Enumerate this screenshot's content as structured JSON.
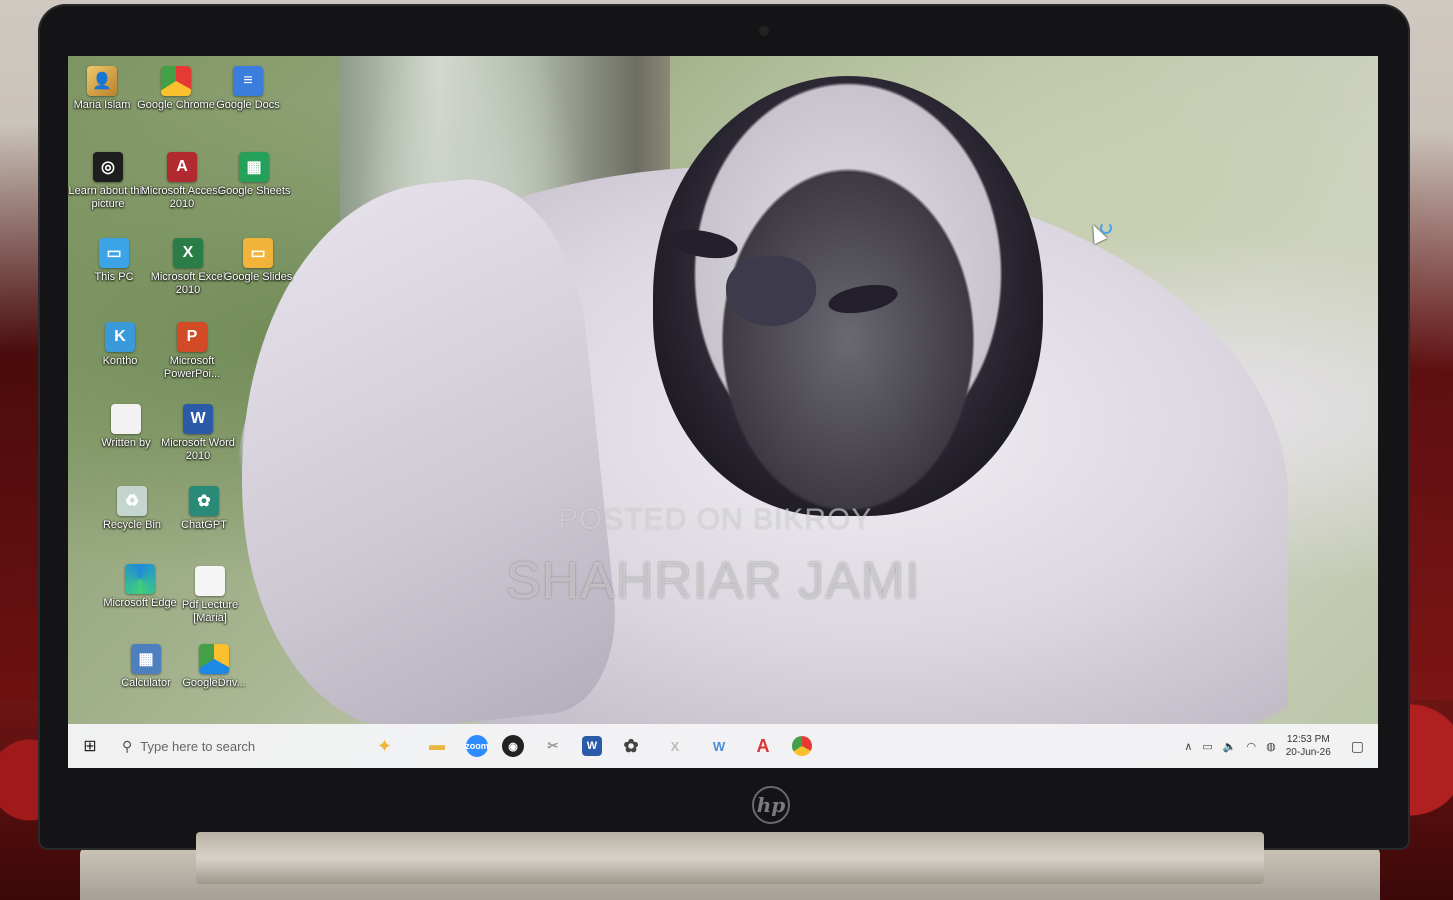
{
  "desktop_icons": [
    {
      "id": "maria-islam",
      "label": "Maria Islam",
      "glyph": "👤"
    },
    {
      "id": "google-chrome",
      "label": "Google Chrome",
      "glyph": ""
    },
    {
      "id": "google-docs",
      "label": "Google Docs",
      "glyph": "≡"
    },
    {
      "id": "learn-about",
      "label": "Learn about this picture",
      "glyph": "◎"
    },
    {
      "id": "ms-access",
      "label": "Microsoft Access 2010",
      "glyph": "A"
    },
    {
      "id": "google-sheets",
      "label": "Google Sheets",
      "glyph": "▦"
    },
    {
      "id": "this-pc",
      "label": "This PC",
      "glyph": "▭"
    },
    {
      "id": "ms-excel",
      "label": "Microsoft Excel 2010",
      "glyph": "X"
    },
    {
      "id": "google-slides",
      "label": "Google Slides",
      "glyph": "▭"
    },
    {
      "id": "kontho",
      "label": "Kontho",
      "glyph": "K"
    },
    {
      "id": "ms-powerpoint",
      "label": "Microsoft PowerPoi...",
      "glyph": "P"
    },
    {
      "id": "written-by",
      "label": "Written by",
      "glyph": ""
    },
    {
      "id": "ms-word",
      "label": "Microsoft Word 2010",
      "glyph": "W"
    },
    {
      "id": "recycle-bin",
      "label": "Recycle Bin",
      "glyph": "♻"
    },
    {
      "id": "chatgpt",
      "label": "ChatGPT",
      "glyph": "✿"
    },
    {
      "id": "ms-edge",
      "label": "Microsoft Edge",
      "glyph": ""
    },
    {
      "id": "pdf-lecture",
      "label": "Pdf Lecture [Maria]",
      "glyph": ""
    },
    {
      "id": "calculator",
      "label": "Calculator",
      "glyph": "▦"
    },
    {
      "id": "google-drive",
      "label": "GoogleDriv...",
      "glyph": ""
    }
  ],
  "watermark": {
    "line1": "POSTED ON BIKROY",
    "line2": "SHAHRIAR JAMI"
  },
  "taskbar": {
    "start_glyph": "⊞",
    "search_placeholder": "Type here to search",
    "search_glyph": "⚲",
    "search_highlight_glyph": "✦",
    "apps": [
      {
        "id": "file-explorer",
        "glyph": "▬"
      },
      {
        "id": "zoom",
        "glyph": "zoom"
      },
      {
        "id": "obs",
        "glyph": "◉"
      },
      {
        "id": "snipping",
        "glyph": "✂"
      },
      {
        "id": "word",
        "glyph": "W"
      },
      {
        "id": "chatgpt",
        "glyph": "✿"
      },
      {
        "id": "excel",
        "glyph": "X"
      },
      {
        "id": "wordpad",
        "glyph": "W"
      },
      {
        "id": "acrobat",
        "glyph": "A"
      },
      {
        "id": "chrome",
        "glyph": ""
      }
    ],
    "tray": {
      "chevron": "∧",
      "battery": "▭",
      "volume": "🔈",
      "wifi": "◠",
      "lang": "◍",
      "time": "12:53 PM",
      "date": "20-Jun-26",
      "notifications": "▢"
    }
  },
  "hardware": {
    "logo_text": "hp"
  },
  "colors": {
    "taskbar_bg": "#f4f4f6",
    "accent": "#2b5aa8"
  }
}
